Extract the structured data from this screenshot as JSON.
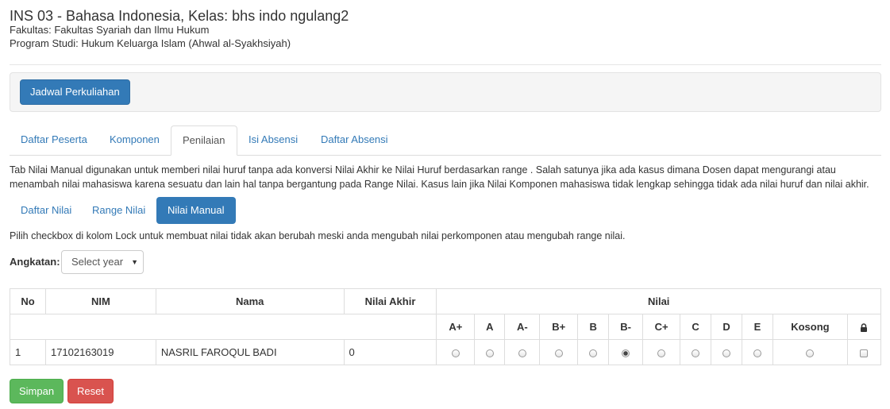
{
  "header": {
    "title": "INS 03 - Bahasa Indonesia, Kelas: bhs indo ngulang2",
    "fakultas": "Fakultas: Fakultas Syariah dan Ilmu Hukum",
    "prodi": "Program Studi: Hukum Keluarga Islam (Ahwal al-Syakhsiyah)"
  },
  "toolbar": {
    "jadwal_label": "Jadwal Perkuliahan"
  },
  "tabs": [
    {
      "label": "Daftar Peserta"
    },
    {
      "label": "Komponen"
    },
    {
      "label": "Penilaian",
      "active": true
    },
    {
      "label": "Isi Absensi"
    },
    {
      "label": "Daftar Absensi"
    }
  ],
  "description": "Tab Nilai Manual digunakan untuk memberi nilai huruf tanpa ada konversi Nilai Akhir ke Nilai Huruf berdasarkan range . Salah satunya jika ada kasus dimana Dosen dapat mengurangi atau menambah nilai mahasiswa karena sesuatu dan lain hal tanpa bergantung pada Range Nilai. Kasus lain jika Nilai Komponen mahasiswa tidak lengkap sehingga tidak ada nilai huruf dan nilai akhir.",
  "subtabs": [
    {
      "label": "Daftar Nilai"
    },
    {
      "label": "Range Nilai"
    },
    {
      "label": "Nilai Manual",
      "active": true
    }
  ],
  "note": "Pilih checkbox di kolom Lock untuk membuat nilai tidak akan berubah meski anda mengubah nilai perkomponen atau mengubah range nilai.",
  "angkatan": {
    "label": "Angkatan:",
    "selected": "Select year"
  },
  "table": {
    "headers": {
      "no": "No",
      "nim": "NIM",
      "nama": "Nama",
      "nilai_akhir": "Nilai Akhir",
      "nilai": "Nilai"
    },
    "grades": [
      "A+",
      "A",
      "A-",
      "B+",
      "B",
      "B-",
      "C+",
      "C",
      "D",
      "E",
      "Kosong"
    ],
    "lock_icon": "lock-icon",
    "rows": [
      {
        "no": "1",
        "nim": "17102163019",
        "nama": "NASRIL FAROQUL BADI",
        "nilai_akhir": "0",
        "selected_grade": "B-",
        "locked": false
      }
    ]
  },
  "actions": {
    "simpan": "Simpan",
    "reset": "Reset"
  },
  "colors": {
    "primary": "#337ab7",
    "success": "#5cb85c",
    "danger": "#d9534f"
  }
}
